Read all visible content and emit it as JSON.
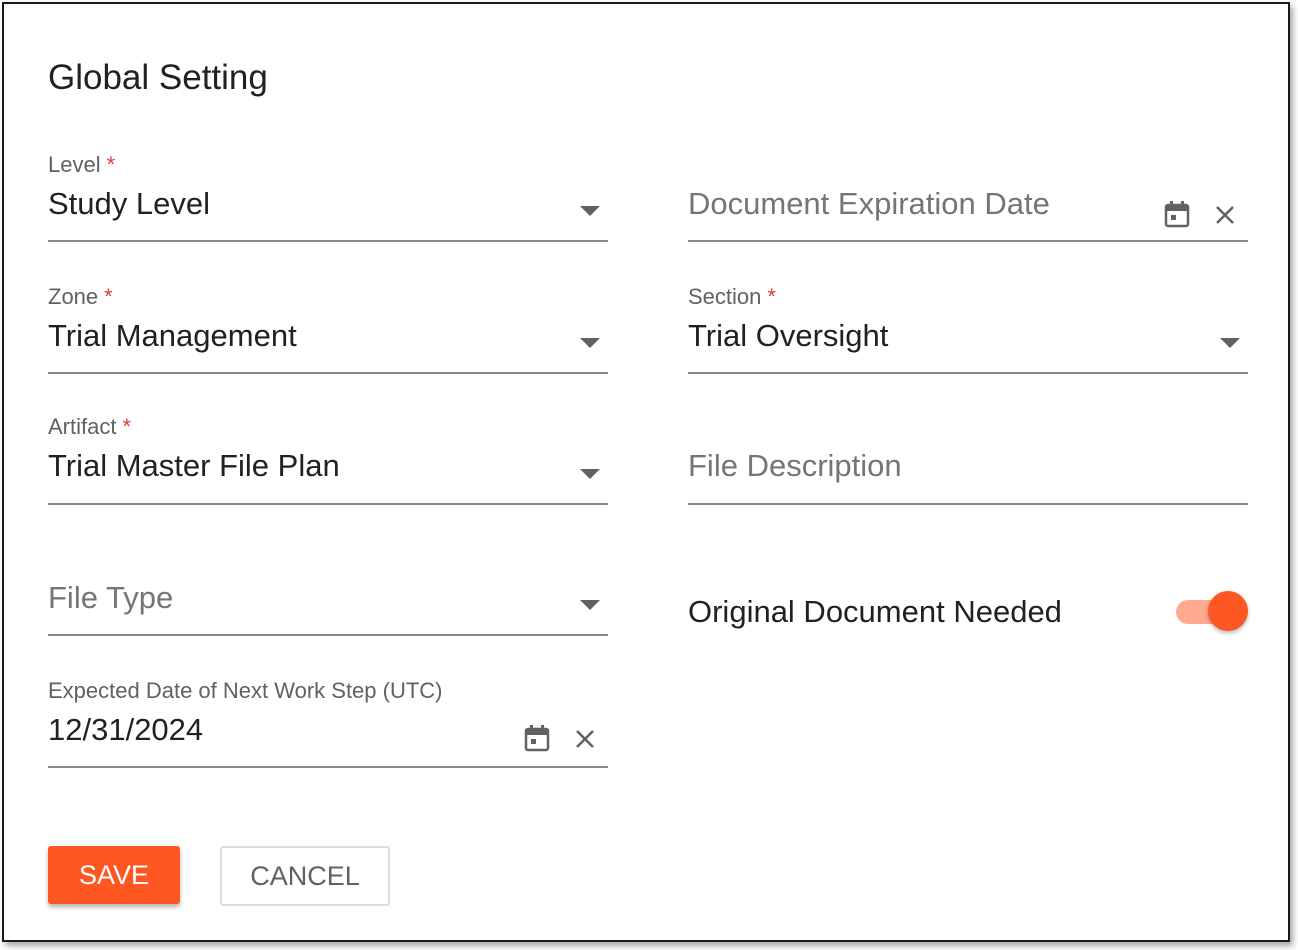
{
  "dialog": {
    "title": "Global Setting",
    "required_marker": "*",
    "fields": {
      "level": {
        "label": "Level",
        "value": "Study Level",
        "required": true
      },
      "zone": {
        "label": "Zone",
        "value": "Trial Management",
        "required": true
      },
      "artifact": {
        "label": "Artifact",
        "value": "Trial Master File Plan",
        "required": true
      },
      "file_type": {
        "placeholder": "File Type",
        "value": ""
      },
      "expected_date": {
        "label": "Expected Date of Next Work Step (UTC)",
        "value": "12/31/2024"
      },
      "expiration_date": {
        "placeholder": "Document Expiration Date",
        "value": ""
      },
      "section": {
        "label": "Section",
        "value": "Trial Oversight",
        "required": true
      },
      "file_description": {
        "placeholder": "File Description",
        "value": ""
      }
    },
    "toggle": {
      "label": "Original Document Needed",
      "checked": true
    },
    "buttons": {
      "save": "SAVE",
      "cancel": "CANCEL"
    },
    "icons": {
      "calendar": "calendar-icon",
      "clear": "close-icon",
      "dropdown": "chevron-down-icon"
    },
    "colors": {
      "accent": "#ff5722",
      "accent_light": "#ffab91",
      "required": "#e53935"
    }
  }
}
